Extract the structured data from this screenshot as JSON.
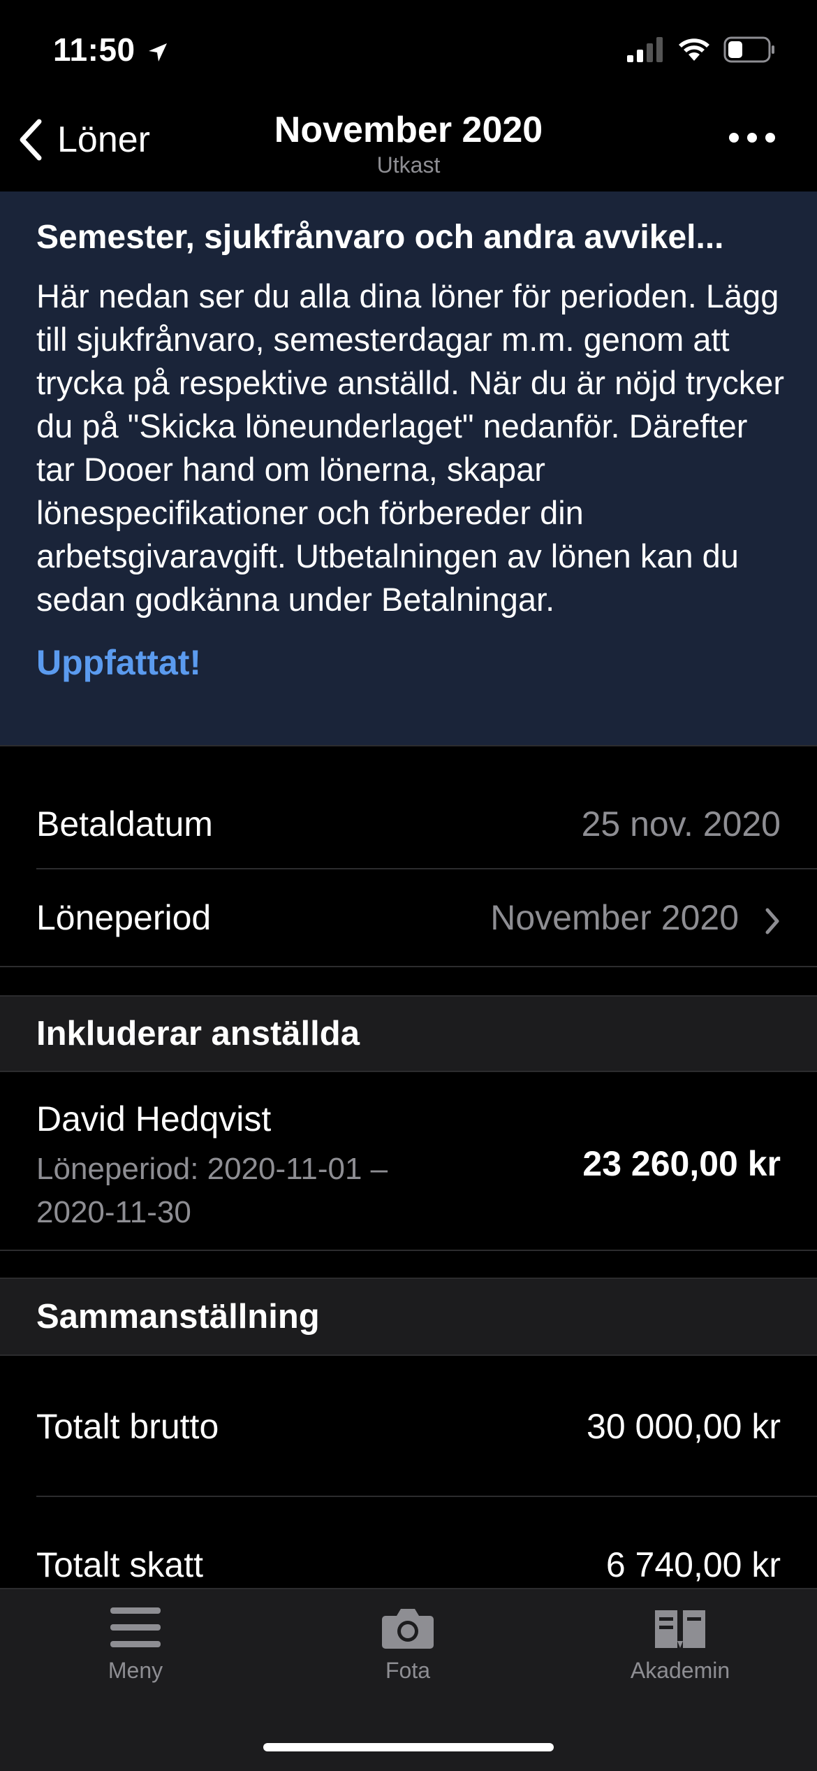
{
  "status_bar": {
    "time": "11:50"
  },
  "nav": {
    "back_label": "Löner",
    "title": "November 2020",
    "subtitle": "Utkast"
  },
  "banner": {
    "title": "Semester, sjukfrånvaro och andra avvikel...",
    "body": "Här nedan ser du alla dina löner för perioden. Lägg till sjukfrånvaro, semesterdagar m.m. genom att trycka på respektive anställd. När du är nöjd trycker du på \"Skicka löneunderlaget\" nedanför. Därefter tar Dooer hand om lönerna, skapar lönespecifikationer och förbereder din arbetsgivaravgift. Utbetalningen av lönen kan du sedan godkänna under Betalningar.",
    "link_label": "Uppfattat!"
  },
  "details": {
    "paydate_label": "Betaldatum",
    "paydate_value": "25 nov. 2020",
    "period_label": "Löneperiod",
    "period_value": "November 2020"
  },
  "employees": {
    "header": "Inkluderar anställda",
    "items": [
      {
        "name": "David Hedqvist",
        "period_line1": "Löneperiod: 2020-11-01 –",
        "period_line2": "2020-11-30",
        "amount": "23 260,00 kr"
      }
    ]
  },
  "summary": {
    "header": "Sammanställning",
    "gross_label": "Totalt brutto",
    "gross_value": "30 000,00 kr",
    "tax_label": "Totalt skatt",
    "tax_value": "6 740,00 kr"
  },
  "tabbar": {
    "items": [
      {
        "label": "Meny",
        "icon": "menu-icon"
      },
      {
        "label": "Fota",
        "icon": "camera-icon"
      },
      {
        "label": "Akademin",
        "icon": "book-icon"
      }
    ]
  },
  "colors": {
    "background": "#000000",
    "banner_bg": "#1a2439",
    "accent_link": "#5b9bef",
    "secondary_text": "#8e8e93",
    "section_bg": "#1c1c1e"
  }
}
